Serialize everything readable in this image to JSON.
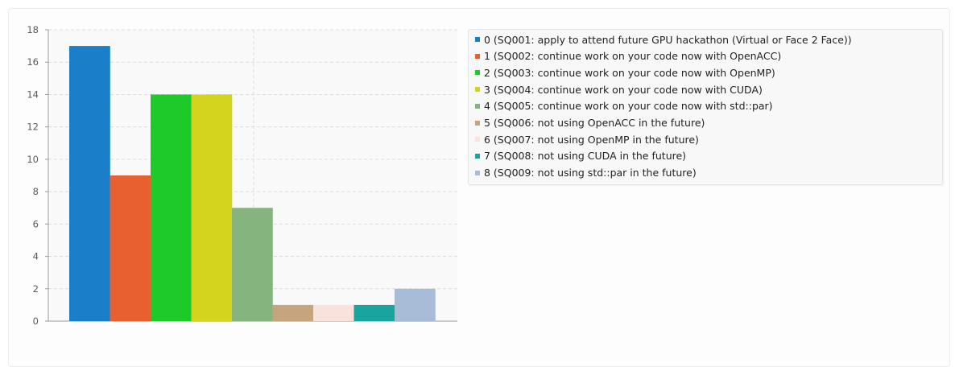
{
  "chart_data": {
    "type": "bar",
    "categories": [
      "0",
      "1",
      "2",
      "3",
      "4",
      "5",
      "6",
      "7",
      "8"
    ],
    "values": [
      17,
      9,
      14,
      14,
      7,
      1,
      1,
      1,
      2
    ],
    "colors": [
      "#1a7fc8",
      "#e86030",
      "#1ec92a",
      "#d4d41e",
      "#86b47e",
      "#c6a47e",
      "#fae2dc",
      "#1aa4a0",
      "#a8bcd8"
    ],
    "legend": [
      "0 (SQ001: apply to attend future GPU hackathon (Virtual or Face 2 Face))",
      "1 (SQ002: continue work on your code now with OpenACC)",
      "2 (SQ003: continue work on your code now with OpenMP)",
      "3 (SQ004: continue work on your code now with CUDA)",
      "4 (SQ005: continue work on your code now with std::par)",
      "5 (SQ006: not using OpenACC in the future)",
      "6 (SQ007: not using OpenMP in the future)",
      "7 (SQ008: not using CUDA in the future)",
      "8 (SQ009: not using std::par in the future)"
    ],
    "legend_position": "right",
    "ylim": [
      0,
      18
    ],
    "yticks": [
      0,
      2,
      4,
      6,
      8,
      10,
      12,
      14,
      16,
      18
    ],
    "grid": true,
    "title": "",
    "xlabel": "",
    "ylabel": ""
  }
}
